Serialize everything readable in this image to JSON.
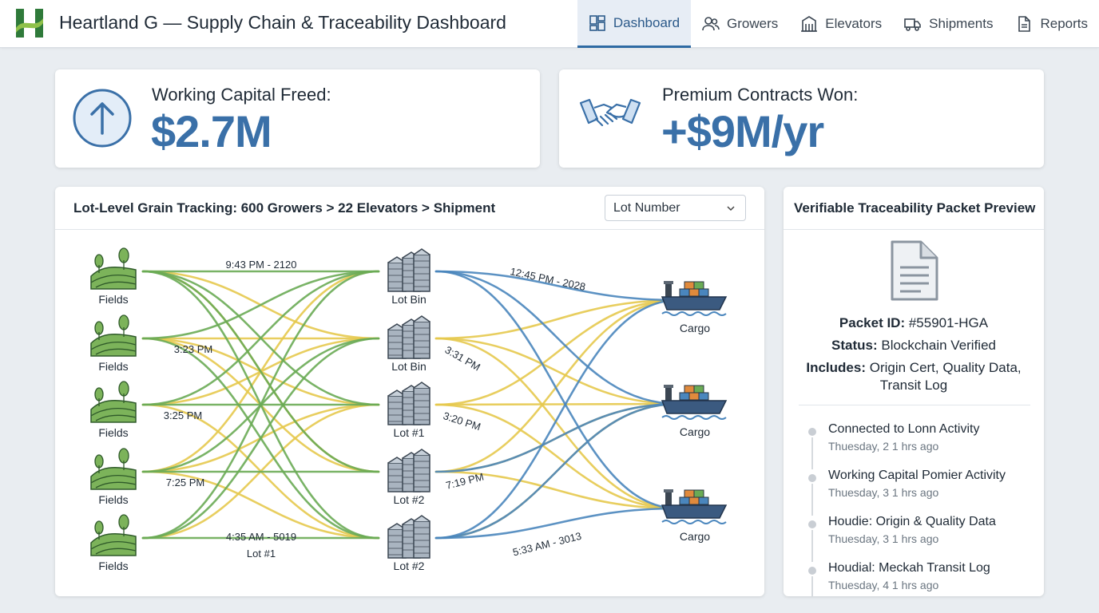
{
  "app": {
    "title": "Heartland G — Supply Chain & Traceability Dashboard"
  },
  "nav": [
    {
      "label": "Dashboard",
      "icon": "dashboard-icon",
      "active": true
    },
    {
      "label": "Growers",
      "icon": "users-icon",
      "active": false
    },
    {
      "label": "Elevators",
      "icon": "building-icon",
      "active": false
    },
    {
      "label": "Shipments",
      "icon": "truck-icon",
      "active": false
    },
    {
      "label": "Reports",
      "icon": "document-icon",
      "active": false
    }
  ],
  "kpis": {
    "working_capital": {
      "title": "Working Capital Freed:",
      "value": "$2.7M",
      "icon": "arrow-up-circle-icon"
    },
    "premium_contracts": {
      "title": "Premium Contracts Won:",
      "value": "+$9M/yr",
      "icon": "handshake-icon"
    }
  },
  "tracking": {
    "title": "Lot-Level Grain Tracking: 600 Growers > 22 Elevators > Shipment",
    "select_value": "Lot Number",
    "fields": [
      "Fields",
      "Fields",
      "Fields",
      "Fields",
      "Fields"
    ],
    "bins": [
      "Lot Bin",
      "Lot Bin",
      "Lot #1",
      "Lot #2",
      "Lot #2"
    ],
    "cargo": [
      "Cargo",
      "Cargo",
      "Cargo"
    ],
    "left_labels": [
      "9:43 PM - 2120",
      "3:23 PM",
      "3:25 PM",
      "7:25 PM",
      "4:35 AM - 5019",
      "Lot #1"
    ],
    "right_labels": [
      "12:45 PM - 2028",
      "3:31 PM",
      "3:20 PM",
      "7:19 PM",
      "5:33 AM - 3013"
    ],
    "colors": {
      "green": "#6aab55",
      "yellow": "#e6c94e",
      "blue": "#4a86bd"
    }
  },
  "packet": {
    "title": "Verifiable Traceability Packet Preview",
    "icon": "document-icon",
    "id_label": "Packet ID:",
    "id_value": "#55901-HGA",
    "status_label": "Status:",
    "status_value": "Blockchain Verified",
    "includes_label": "Includes:",
    "includes_value_1": "Origin Cert, Quality Data,",
    "includes_value_2": "Transit Log",
    "timeline": [
      {
        "title": "Connected to Lonn Activity",
        "time": "Thuesday, 2 1 hrs ago"
      },
      {
        "title": "Working Capital Pomier Activity",
        "time": "Thuesday, 3 1 hrs ago"
      },
      {
        "title": "Houdie: Origin & Quality Data",
        "time": "Thuesday, 3 1 hrs ago"
      },
      {
        "title": "Houdial: Meckah Transit Log",
        "time": "Thuesday, 4 1 hrs ago"
      }
    ]
  }
}
